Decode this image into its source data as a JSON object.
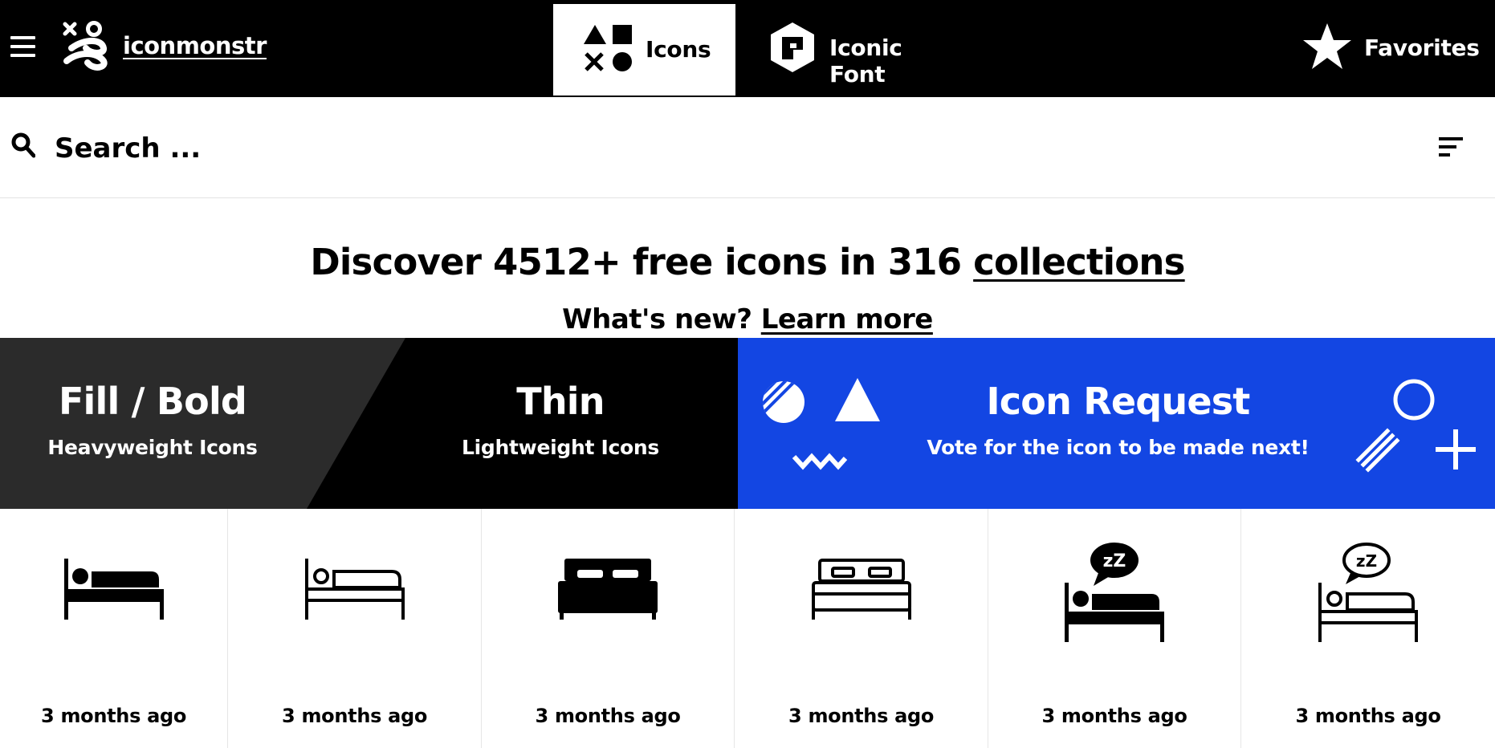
{
  "header": {
    "brand": "iconmonstr",
    "tabs": [
      {
        "label": "Icons",
        "icon": "shapes-icon",
        "active": true
      },
      {
        "label": "Iconic Font",
        "icon": "font-hexagon-icon",
        "active": false
      },
      {
        "label": "Favorites",
        "icon": "star-icon",
        "active": false
      }
    ]
  },
  "search": {
    "placeholder": "Search ...",
    "value": ""
  },
  "hero": {
    "headline_prefix": "Discover 4512+ free icons in 316 ",
    "headline_link": "collections",
    "sub_prefix": "What's new? ",
    "sub_link": "Learn more"
  },
  "banner": {
    "fill_title": "Fill / Bold",
    "fill_sub": "Heavyweight Icons",
    "thin_title": "Thin",
    "thin_sub": "Lightweight Icons",
    "request_title": "Icon Request",
    "request_sub": "Vote for the icon to be made next!",
    "colors": {
      "fill": "#2b2b2b",
      "thin": "#000000",
      "request": "#1346e3"
    }
  },
  "icons": [
    {
      "name": "bed-filled-icon",
      "time": "3 months ago"
    },
    {
      "name": "bed-outline-icon",
      "time": "3 months ago"
    },
    {
      "name": "double-bed-filled-icon",
      "time": "3 months ago"
    },
    {
      "name": "double-bed-outline-icon",
      "time": "3 months ago"
    },
    {
      "name": "sleeping-filled-icon",
      "time": "3 months ago"
    },
    {
      "name": "sleeping-outline-icon",
      "time": "3 months ago"
    }
  ]
}
